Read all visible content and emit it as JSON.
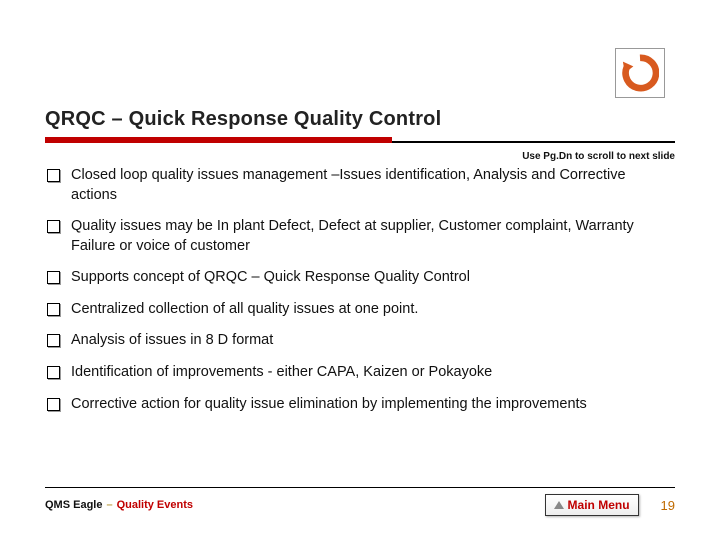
{
  "title": "QRQC – Quick Response Quality Control",
  "hint": "Use Pg.Dn to scroll to next slide",
  "bullets": [
    "Closed loop quality issues management –Issues identification, Analysis and Corrective actions",
    "Quality issues may be In plant Defect, Defect at supplier, Customer complaint, Warranty Failure or voice of customer",
    "Supports concept of QRQC – Quick Response Quality Control",
    "Centralized collection of all quality issues at one point.",
    "Analysis of issues in 8 D format",
    "Identification of improvements - either CAPA, Kaizen or Pokayoke",
    "Corrective action for quality issue elimination by implementing the improvements"
  ],
  "footer": {
    "brand": "QMS Eagle",
    "separator": "–",
    "section": "Quality Events",
    "mainMenuLabel": "Main Menu",
    "pageNumber": "19"
  }
}
